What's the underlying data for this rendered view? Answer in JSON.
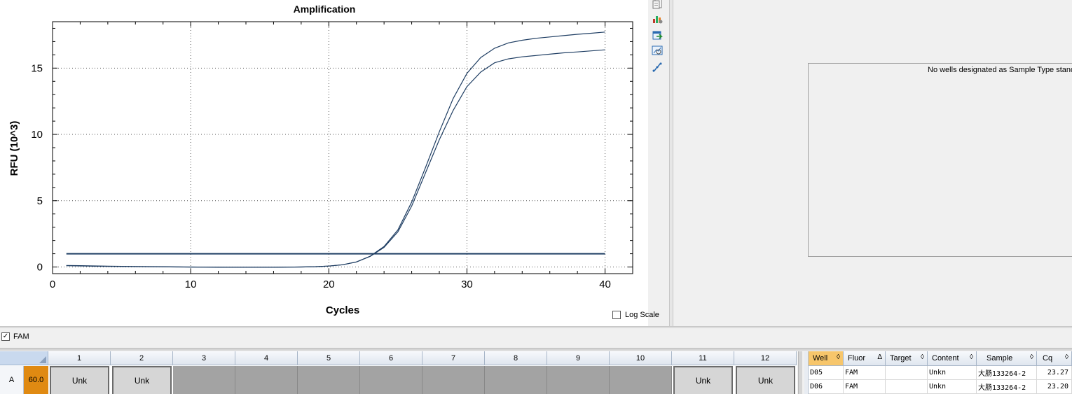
{
  "chart_data": {
    "type": "line",
    "title": "Amplification",
    "xlabel": "Cycles",
    "ylabel": "RFU (10^3)",
    "xlim": [
      0,
      42
    ],
    "ylim": [
      -0.5,
      18.5
    ],
    "x_ticks": [
      0,
      10,
      20,
      30,
      40
    ],
    "y_ticks": [
      0,
      5,
      10,
      15
    ],
    "grid": true,
    "series": [
      {
        "x": [
          1,
          2,
          3,
          4,
          5,
          6,
          7,
          8,
          9,
          10,
          11,
          12,
          13,
          14,
          15,
          16,
          17,
          18,
          19,
          20,
          21,
          22,
          23,
          24,
          25,
          26,
          27,
          28,
          29,
          30,
          31,
          32,
          33,
          34,
          35,
          36,
          37,
          38,
          39,
          40
        ],
        "y": [
          0.12,
          0.1,
          0.08,
          0.06,
          0.05,
          0.04,
          0.03,
          0.02,
          0.01,
          0.0,
          -0.01,
          -0.01,
          -0.02,
          -0.02,
          -0.02,
          -0.02,
          -0.01,
          0.0,
          0.02,
          0.07,
          0.17,
          0.38,
          0.82,
          1.55,
          2.8,
          4.9,
          7.5,
          10.2,
          12.7,
          14.6,
          15.8,
          16.5,
          16.9,
          17.1,
          17.25,
          17.35,
          17.45,
          17.55,
          17.63,
          17.72
        ]
      },
      {
        "x": [
          1,
          2,
          3,
          4,
          5,
          6,
          7,
          8,
          9,
          10,
          11,
          12,
          13,
          14,
          15,
          16,
          17,
          18,
          19,
          20,
          21,
          22,
          23,
          24,
          25,
          26,
          27,
          28,
          29,
          30,
          31,
          32,
          33,
          34,
          35,
          36,
          37,
          38,
          39,
          40
        ],
        "y": [
          0.1,
          0.08,
          0.06,
          0.05,
          0.04,
          0.03,
          0.02,
          0.01,
          0.0,
          -0.01,
          -0.01,
          -0.02,
          -0.02,
          -0.02,
          -0.02,
          -0.02,
          -0.01,
          0.0,
          0.02,
          0.07,
          0.17,
          0.38,
          0.8,
          1.48,
          2.65,
          4.6,
          7.1,
          9.6,
          11.8,
          13.6,
          14.7,
          15.4,
          15.7,
          15.85,
          15.95,
          16.05,
          16.15,
          16.22,
          16.3,
          16.38
        ]
      }
    ],
    "threshold": 1.0,
    "line_color": "#1f3e63"
  },
  "toolbar": {
    "icons": [
      "copy-icon",
      "chart-settings-icon",
      "export-icon",
      "zoom-icon",
      "curve-icon"
    ]
  },
  "log_scale": {
    "label": "Log Scale",
    "checked": false
  },
  "std_curve": {
    "message": "No wells designated as Sample Type standa"
  },
  "fluor": {
    "label": "FAM",
    "checked": true
  },
  "plate": {
    "columns": [
      "1",
      "2",
      "3",
      "4",
      "5",
      "6",
      "7",
      "8",
      "9",
      "10",
      "11",
      "12"
    ],
    "row_label": "A",
    "temp": "60.0",
    "wells": [
      "Unk",
      "Unk",
      "",
      "",
      "",
      "",
      "",
      "",
      "",
      "",
      "Unk",
      "Unk"
    ],
    "temp_color": "#e08a12"
  },
  "results": {
    "headers": [
      {
        "label": "Well",
        "sort": "◊"
      },
      {
        "label": "Fluor",
        "sort": "Δ"
      },
      {
        "label": "Target",
        "sort": "◊"
      },
      {
        "label": "Content",
        "sort": "◊"
      },
      {
        "label": "Sample",
        "sort": "◊"
      },
      {
        "label": "Cq",
        "sort": "◊"
      }
    ],
    "rows": [
      [
        "D05",
        "FAM",
        "",
        "Unkn",
        "大肠133264-2",
        "23.27"
      ],
      [
        "D06",
        "FAM",
        "",
        "Unkn",
        "大肠133264-2",
        "23.20"
      ]
    ]
  }
}
